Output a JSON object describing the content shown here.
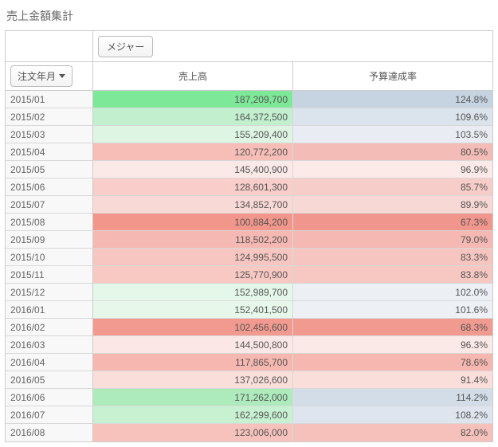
{
  "title": "売上金額集計",
  "buttons": {
    "measure": "メジャー",
    "dimension": "注文年月"
  },
  "columns": [
    "売上高",
    "予算達成率"
  ],
  "rows": [
    {
      "ym": "2015/01",
      "sales": "187,209,700",
      "rate": "124.8%",
      "c1": "#7de898",
      "c2": "#c6d3e0"
    },
    {
      "ym": "2015/02",
      "sales": "164,372,500",
      "rate": "109.6%",
      "c1": "#c2f0ce",
      "c2": "#dbe3ec"
    },
    {
      "ym": "2015/03",
      "sales": "155,209,400",
      "rate": "103.5%",
      "c1": "#def5e3",
      "c2": "#e9edf3"
    },
    {
      "ym": "2015/04",
      "sales": "120,772,200",
      "rate": "80.5%",
      "c1": "#f7bdb7",
      "c2": "#f4bcb6"
    },
    {
      "ym": "2015/05",
      "sales": "145,400,900",
      "rate": "96.9%",
      "c1": "#fbe9e7",
      "c2": "#fbeae8"
    },
    {
      "ym": "2015/06",
      "sales": "128,601,300",
      "rate": "85.7%",
      "c1": "#f8cdca",
      "c2": "#f7cdc9"
    },
    {
      "ym": "2015/07",
      "sales": "134,852,700",
      "rate": "89.9%",
      "c1": "#f9d9d6",
      "c2": "#f8d8d5"
    },
    {
      "ym": "2015/08",
      "sales": "100,884,200",
      "rate": "67.3%",
      "c1": "#f2968c",
      "c2": "#f1968c"
    },
    {
      "ym": "2015/09",
      "sales": "118,502,200",
      "rate": "79.0%",
      "c1": "#f6b8b2",
      "c2": "#f5b8b2"
    },
    {
      "ym": "2015/10",
      "sales": "124,995,500",
      "rate": "83.3%",
      "c1": "#f7c6c1",
      "c2": "#f7c5c0"
    },
    {
      "ym": "2015/11",
      "sales": "125,770,900",
      "rate": "83.8%",
      "c1": "#f8c8c3",
      "c2": "#f7c7c2"
    },
    {
      "ym": "2015/12",
      "sales": "152,989,700",
      "rate": "102.0%",
      "c1": "#e5f7e9",
      "c2": "#ecf0f5"
    },
    {
      "ym": "2016/01",
      "sales": "152,401,500",
      "rate": "101.6%",
      "c1": "#e7f8eb",
      "c2": "#edf1f6"
    },
    {
      "ym": "2016/02",
      "sales": "102,456,600",
      "rate": "68.3%",
      "c1": "#f29a90",
      "c2": "#f19a90"
    },
    {
      "ym": "2016/03",
      "sales": "144,500,800",
      "rate": "96.3%",
      "c1": "#fbe8e6",
      "c2": "#fbe9e7"
    },
    {
      "ym": "2016/04",
      "sales": "117,865,700",
      "rate": "78.6%",
      "c1": "#f5b7b0",
      "c2": "#f5b7b0"
    },
    {
      "ym": "2016/05",
      "sales": "137,026,600",
      "rate": "91.4%",
      "c1": "#fadeda",
      "c2": "#f9deda"
    },
    {
      "ym": "2016/06",
      "sales": "171,262,000",
      "rate": "114.2%",
      "c1": "#aeebbc",
      "c2": "#d3dde7"
    },
    {
      "ym": "2016/07",
      "sales": "162,299,600",
      "rate": "108.2%",
      "c1": "#c8f1d2",
      "c2": "#dee5ee"
    },
    {
      "ym": "2016/08",
      "sales": "123,006,000",
      "rate": "82.0%",
      "c1": "#f7c2bc",
      "c2": "#f6c1bb"
    }
  ]
}
